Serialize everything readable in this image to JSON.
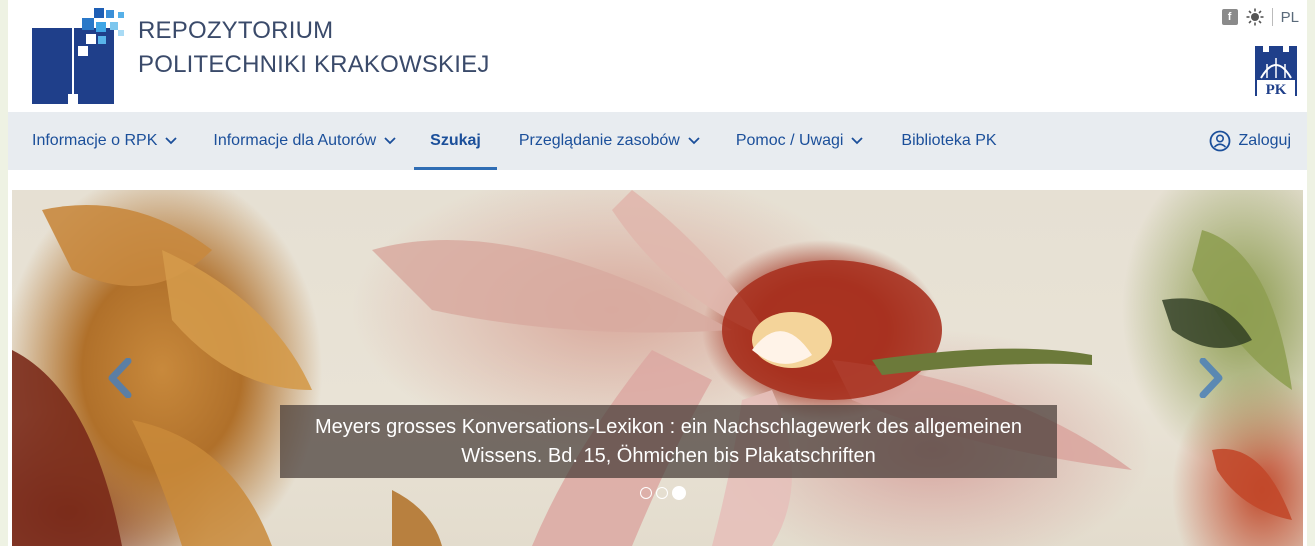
{
  "header": {
    "title_line1": "REPOZYTORIUM",
    "title_line2": "POLITECHNIKI KRAKOWSKIEJ",
    "facebook_icon": "facebook-icon",
    "contrast_icon": "contrast-icon",
    "language": "PL",
    "pk_logo_text": "PK"
  },
  "nav": {
    "items": [
      {
        "label": "Informacje o RPK",
        "dropdown": true
      },
      {
        "label": "Informacje dla Autorów",
        "dropdown": true
      },
      {
        "label": "Szukaj",
        "dropdown": false,
        "active": true
      },
      {
        "label": "Przeglądanie zasobów",
        "dropdown": true
      },
      {
        "label": "Pomoc / Uwagi",
        "dropdown": true
      },
      {
        "label": "Biblioteka PK",
        "dropdown": false
      }
    ],
    "login_label": "Zaloguj"
  },
  "slider": {
    "caption": "Meyers grosses Konversations-Lexikon : ein Nachschlagewerk des allgemeinen Wissens. Bd. 15, Öhmichen bis Plakatschriften",
    "slide_count": 3,
    "active_slide": 3
  },
  "colors": {
    "brand_blue": "#1b4f9a",
    "nav_bg": "#e8ecf0",
    "active_underline": "#2f6db4"
  }
}
